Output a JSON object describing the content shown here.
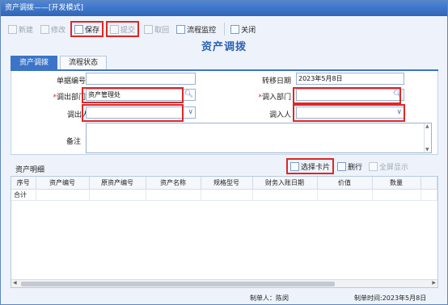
{
  "window": {
    "title": "资产调拨——[开发模式]"
  },
  "toolbar": {
    "new": "新建",
    "edit": "修改",
    "save": "保存",
    "submit": "提交",
    "withdraw": "取回",
    "monitor": "流程监控",
    "close": "关闭"
  },
  "doc_title": "资产调拨",
  "tabs": [
    {
      "label": "资产调拨"
    },
    {
      "label": "流程状态"
    }
  ],
  "form": {
    "doc_no_label": "单据编号",
    "doc_no_value": "",
    "transfer_date_label": "转移日期",
    "transfer_date_value": "2023年5月8日",
    "out_dept_label": "调出部门",
    "out_dept_value": "资产管理处",
    "in_dept_label": "调入部门",
    "in_dept_value": "",
    "out_person_label": "调出人",
    "out_person_value": "",
    "in_person_label": "调入人",
    "in_person_value": "",
    "remark_label": "备注",
    "remark_value": ""
  },
  "detail": {
    "title": "资产明细",
    "select_card": "选择卡片",
    "delete_row": "删行",
    "fullscreen": "全屏显示",
    "columns": [
      "序号",
      "资产编号",
      "原资产编号",
      "资产名称",
      "规格型号",
      "财务入账日期",
      "价值",
      "数量"
    ],
    "total_label": "合计"
  },
  "footer": {
    "creator": "制单人：陈闵",
    "created_time": "制单时间:2023年5月8日"
  },
  "colors": {
    "highlight": "#e02626",
    "accent": "#3c74c8"
  }
}
